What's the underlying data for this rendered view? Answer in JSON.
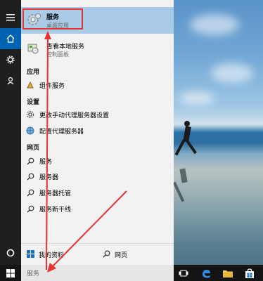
{
  "best_match": {
    "title": "服务",
    "subtitle": "桌面应用"
  },
  "control_panel_result": {
    "title": "查看本地服务",
    "subtitle": "控制面板"
  },
  "sections": {
    "apps_header": "应用",
    "settings_header": "设置",
    "web_header": "网页"
  },
  "apps": [
    {
      "label": "组件服务"
    }
  ],
  "settings": [
    {
      "label": "更改手动代理服务器设置"
    },
    {
      "label": "配置代理服务器"
    }
  ],
  "web": [
    {
      "label": "服务"
    },
    {
      "label": "服务器"
    },
    {
      "label": "服务器托管"
    },
    {
      "label": "服务新干线"
    }
  ],
  "bottom_tabs": {
    "my_stuff": "我的资料",
    "web": "网页"
  },
  "search": {
    "query": "服务"
  },
  "colors": {
    "accent": "#0063b1",
    "selection": "#aacbe8",
    "annotation_red": "#e33333",
    "taskbar": "#141414"
  }
}
